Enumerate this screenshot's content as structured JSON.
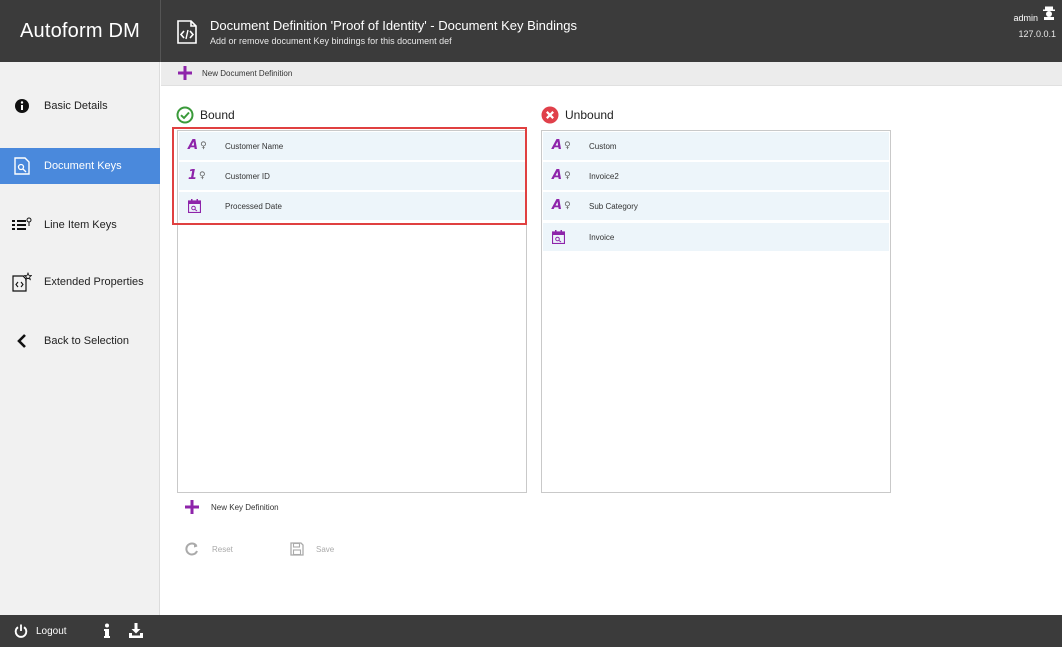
{
  "app": {
    "brand": "Autoform DM",
    "title": "Document Definition 'Proof of Identity' - Document Key Bindings",
    "subtitle": "Add or remove document Key bindings for this document def",
    "user": "admin",
    "ip": "127.0.0.1"
  },
  "sidebar": {
    "items": [
      {
        "label": "Basic Details",
        "icon": "info-icon"
      },
      {
        "label": "Document Keys",
        "icon": "document-key-icon",
        "active": true
      },
      {
        "label": "Line Item Keys",
        "icon": "list-key-icon"
      },
      {
        "label": "Extended Properties",
        "icon": "extended-properties-icon"
      },
      {
        "label": "Back to Selection",
        "icon": "chevron-left-icon"
      }
    ]
  },
  "toolbar": {
    "new_document_definition": "New Document Definition"
  },
  "bound": {
    "title": "Bound",
    "items": [
      {
        "label": "Customer Name",
        "type": "text"
      },
      {
        "label": "Customer ID",
        "type": "number"
      },
      {
        "label": "Processed Date",
        "type": "date"
      }
    ]
  },
  "unbound": {
    "title": "Unbound",
    "items": [
      {
        "label": "Custom",
        "type": "text"
      },
      {
        "label": "Invoice2",
        "type": "text"
      },
      {
        "label": "Sub Category",
        "type": "text"
      },
      {
        "label": "Invoice",
        "type": "date"
      }
    ]
  },
  "actions": {
    "new_key_definition": "New Key Definition",
    "reset": "Reset",
    "save": "Save"
  },
  "footer": {
    "logout": "Logout"
  },
  "colors": {
    "header_bg": "#3b3b3b",
    "active_nav": "#4a89dc",
    "accent_purple": "#8e24aa",
    "row_bg": "#edf5fa",
    "highlight_red": "#e04040",
    "bound_green": "#3a9a3a",
    "unbound_red": "#e0404a"
  }
}
